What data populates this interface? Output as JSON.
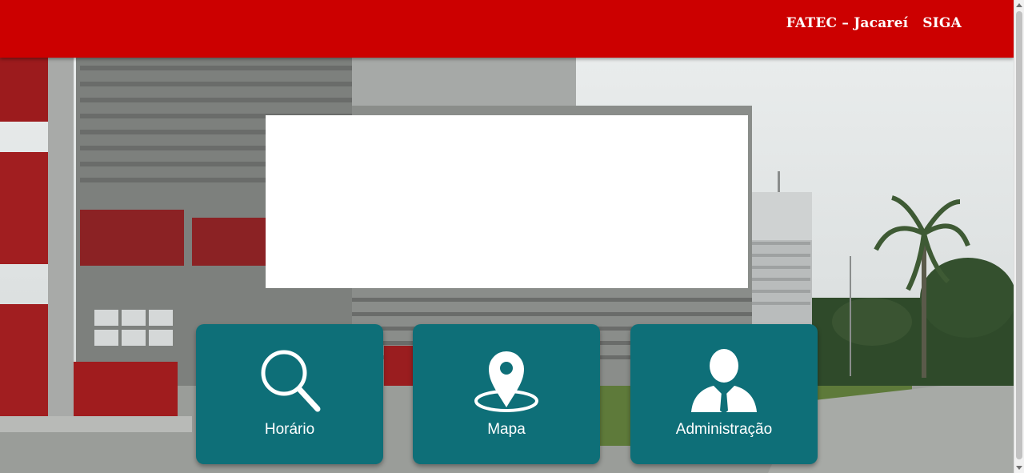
{
  "navbar": {
    "links": [
      "FATEC – Jacareí",
      "SIGA"
    ],
    "background_color": "#cc0000"
  },
  "tiles": [
    {
      "label": "Horário",
      "icon": "search-icon"
    },
    {
      "label": "Mapa",
      "icon": "map-pin-icon"
    },
    {
      "label": "Administração",
      "icon": "person-icon"
    }
  ],
  "colors": {
    "tile": "#0e6f78",
    "accent": "#cc0000"
  }
}
